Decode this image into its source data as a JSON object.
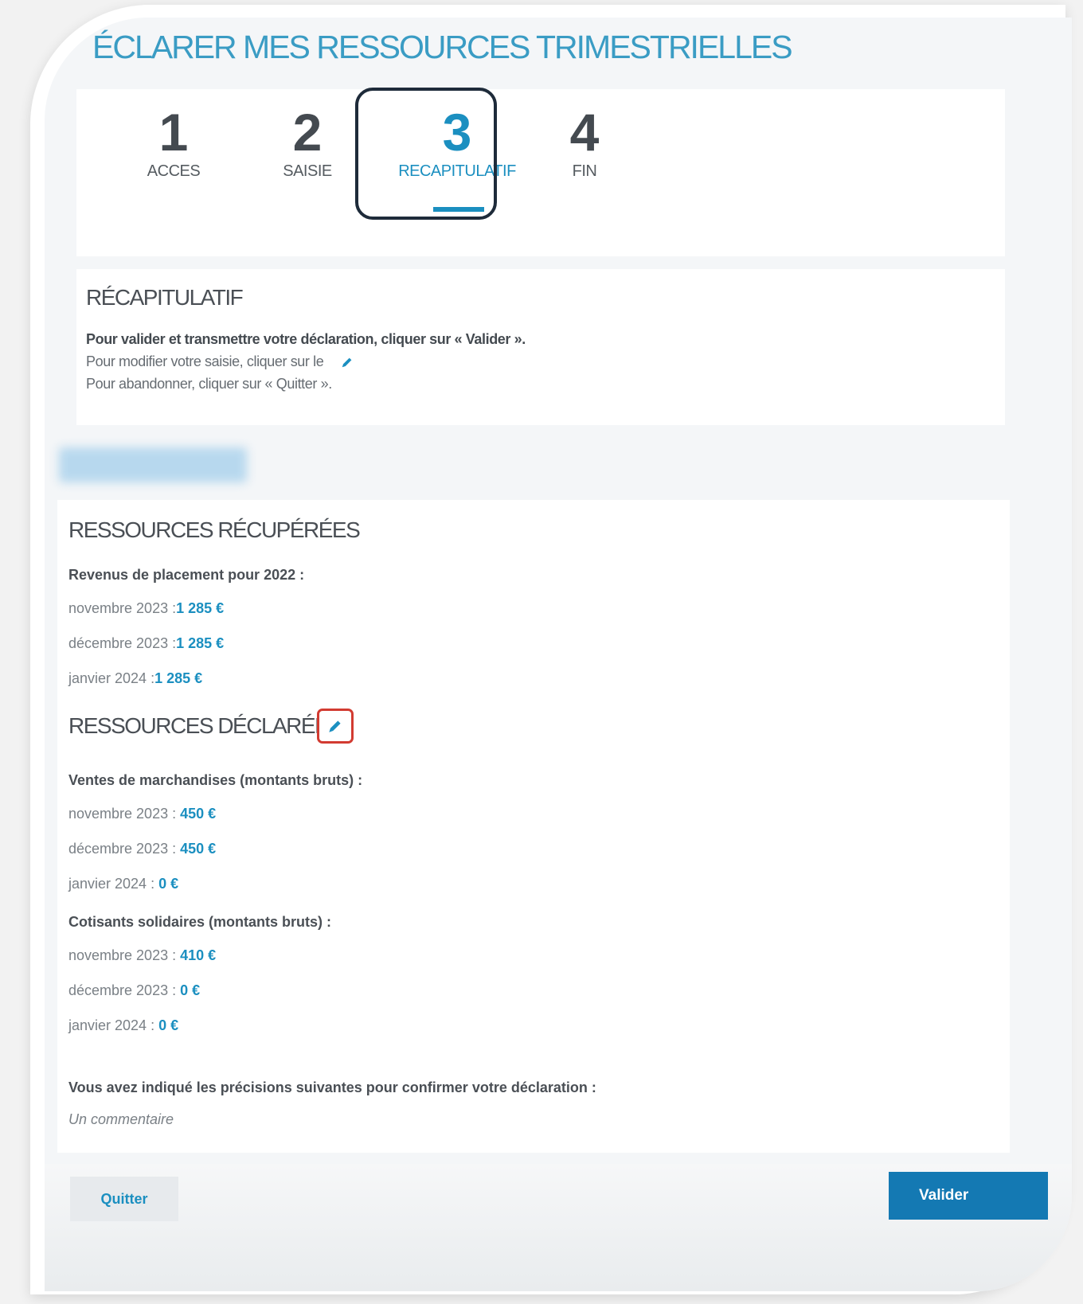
{
  "page": {
    "title": "ÉCLARER MES RESSOURCES TRIMESTRIELLES"
  },
  "stepper": {
    "active_step": 3,
    "steps": [
      {
        "number": "1",
        "label": "ACCES"
      },
      {
        "number": "2",
        "label": "SAISIE"
      },
      {
        "number": "3",
        "label": "RECAPITULATIF"
      },
      {
        "number": "4",
        "label": "FIN"
      }
    ]
  },
  "recap": {
    "heading": "RÉCAPITULATIF",
    "line_validate": "Pour valider et transmettre votre déclaration, cliquer sur « Valider ».",
    "line_modify": "Pour modifier votre saisie, cliquer sur le",
    "line_quit": "Pour abandonner, cliquer sur « Quitter »."
  },
  "recovered": {
    "heading": "RESSOURCES RÉCUPÉRÉES",
    "group_title": "Revenus de placement pour 2022 :",
    "rows": [
      {
        "month": "novembre 2023 :",
        "value": "1 285 €"
      },
      {
        "month": "décembre 2023 :",
        "value": "1 285 €"
      },
      {
        "month": "janvier 2024 :",
        "value": "1 285 €"
      }
    ]
  },
  "declared": {
    "heading": "RESSOURCES DÉCLARÉES",
    "groups": [
      {
        "title": "Ventes de marchandises (montants bruts) :",
        "rows": [
          {
            "month": "novembre 2023 : ",
            "value": "450 €"
          },
          {
            "month": "décembre 2023 : ",
            "value": "450 €"
          },
          {
            "month": "janvier 2024 : ",
            "value": "0 €"
          }
        ]
      },
      {
        "title": "Cotisants solidaires (montants bruts) :",
        "rows": [
          {
            "month": "novembre 2023 : ",
            "value": "410 €"
          },
          {
            "month": "décembre 2023 : ",
            "value": "0 €"
          },
          {
            "month": "janvier 2024 : ",
            "value": "0 €"
          }
        ]
      }
    ]
  },
  "precisions": {
    "label": "Vous avez indiqué les précisions suivantes pour confirmer votre déclaration :",
    "comment": "Un commentaire"
  },
  "footer": {
    "quit_label": "Quitter",
    "validate_label": "Valider"
  },
  "colors": {
    "accent": "#1b8fc0",
    "highlight_border": "#1e2b3a",
    "edit_highlight": "#d23b31"
  },
  "icons": {
    "edit": "pencil-icon"
  }
}
